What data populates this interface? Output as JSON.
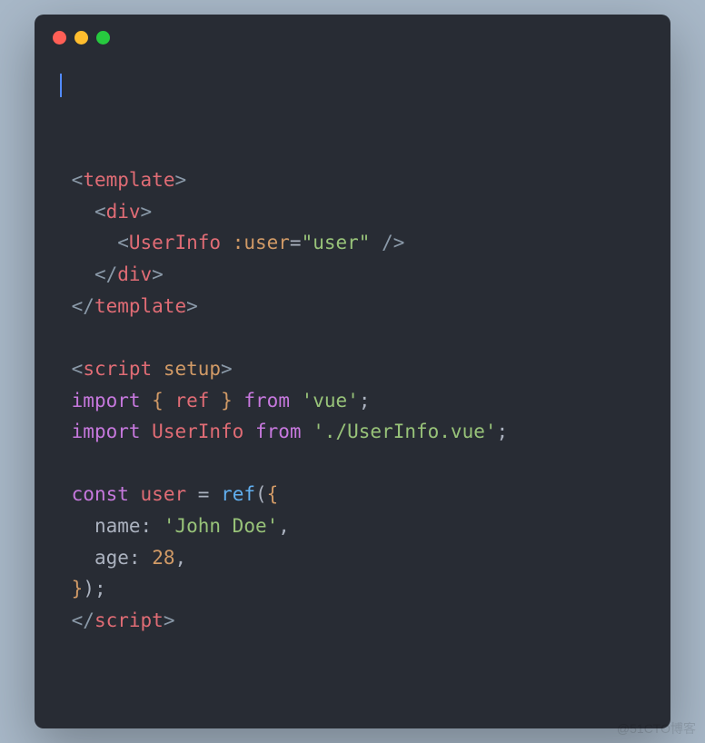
{
  "window": {
    "dots": [
      "red",
      "yellow",
      "green"
    ]
  },
  "code": {
    "lines": [
      {
        "i": " ",
        "t": [
          [
            "tag-bracket",
            "<"
          ],
          [
            "tag-name",
            "template"
          ],
          [
            "tag-bracket",
            ">"
          ]
        ]
      },
      {
        "i": "   ",
        "t": [
          [
            "tag-bracket",
            "<"
          ],
          [
            "tag-name",
            "div"
          ],
          [
            "tag-bracket",
            ">"
          ]
        ]
      },
      {
        "i": "     ",
        "t": [
          [
            "tag-bracket",
            "<"
          ],
          [
            "tag-name",
            "UserInfo"
          ],
          [
            "plain",
            " "
          ],
          [
            "attr-name",
            ":user"
          ],
          [
            "punct",
            "="
          ],
          [
            "attr-value",
            "\"user\""
          ],
          [
            "plain",
            " "
          ],
          [
            "tag-bracket",
            "/>"
          ]
        ]
      },
      {
        "i": "   ",
        "t": [
          [
            "tag-bracket",
            "</"
          ],
          [
            "tag-name",
            "div"
          ],
          [
            "tag-bracket",
            ">"
          ]
        ]
      },
      {
        "i": " ",
        "t": [
          [
            "tag-bracket",
            "</"
          ],
          [
            "tag-name",
            "template"
          ],
          [
            "tag-bracket",
            ">"
          ]
        ]
      },
      {
        "i": "",
        "t": []
      },
      {
        "i": " ",
        "t": [
          [
            "tag-bracket",
            "<"
          ],
          [
            "tag-name",
            "script"
          ],
          [
            "plain",
            " "
          ],
          [
            "attr-name",
            "setup"
          ],
          [
            "tag-bracket",
            ">"
          ]
        ]
      },
      {
        "i": " ",
        "t": [
          [
            "keyword",
            "import"
          ],
          [
            "plain",
            " "
          ],
          [
            "brace",
            "{"
          ],
          [
            "plain",
            " "
          ],
          [
            "ident",
            "ref"
          ],
          [
            "plain",
            " "
          ],
          [
            "brace",
            "}"
          ],
          [
            "plain",
            " "
          ],
          [
            "keyword",
            "from"
          ],
          [
            "plain",
            " "
          ],
          [
            "string",
            "'vue'"
          ],
          [
            "punct",
            ";"
          ]
        ]
      },
      {
        "i": " ",
        "t": [
          [
            "keyword",
            "import"
          ],
          [
            "plain",
            " "
          ],
          [
            "ident",
            "UserInfo"
          ],
          [
            "plain",
            " "
          ],
          [
            "keyword",
            "from"
          ],
          [
            "plain",
            " "
          ],
          [
            "string",
            "'./UserInfo.vue'"
          ],
          [
            "punct",
            ";"
          ]
        ]
      },
      {
        "i": "",
        "t": []
      },
      {
        "i": " ",
        "t": [
          [
            "keyword",
            "const"
          ],
          [
            "plain",
            " "
          ],
          [
            "ident",
            "user"
          ],
          [
            "plain",
            " "
          ],
          [
            "punct",
            "="
          ],
          [
            "plain",
            " "
          ],
          [
            "func",
            "ref"
          ],
          [
            "punct",
            "("
          ],
          [
            "brace",
            "{"
          ]
        ]
      },
      {
        "i": "   ",
        "t": [
          [
            "prop",
            "name"
          ],
          [
            "punct",
            ":"
          ],
          [
            "plain",
            " "
          ],
          [
            "string",
            "'John Doe'"
          ],
          [
            "punct",
            ","
          ]
        ]
      },
      {
        "i": "   ",
        "t": [
          [
            "prop",
            "age"
          ],
          [
            "punct",
            ":"
          ],
          [
            "plain",
            " "
          ],
          [
            "number",
            "28"
          ],
          [
            "punct",
            ","
          ]
        ]
      },
      {
        "i": " ",
        "t": [
          [
            "brace",
            "}"
          ],
          [
            "punct",
            ")"
          ],
          [
            "punct",
            ";"
          ]
        ]
      },
      {
        "i": " ",
        "t": [
          [
            "tag-bracket",
            "</"
          ],
          [
            "tag-name",
            "script"
          ],
          [
            "tag-bracket",
            ">"
          ]
        ]
      }
    ]
  },
  "watermark": "@51CTO博客"
}
